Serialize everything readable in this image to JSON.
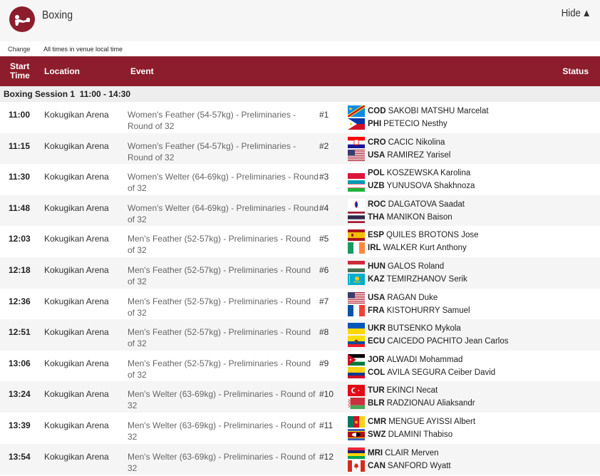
{
  "header": {
    "sport": "Boxing",
    "hide_label": "Hide"
  },
  "subbar": {
    "change_label": "Change",
    "timezone_note": "All times in venue local time"
  },
  "columns": {
    "start_time": "Start Time",
    "location": "Location",
    "event": "Event",
    "status": "Status"
  },
  "session": {
    "label": "Boxing Session 1  11:00 - 14:30"
  },
  "rows": [
    {
      "time": "11:00",
      "location": "Kokugikan Arena",
      "event": "Women's Feather (54-57kg) - Preliminaries - Round of 32",
      "num": "#1",
      "a": {
        "noc": "COD",
        "name": "SAKOBI MATSHU Marcelat",
        "flag": "cod"
      },
      "b": {
        "noc": "PHI",
        "name": "PETECIO Nesthy",
        "flag": "phi"
      }
    },
    {
      "time": "11:15",
      "location": "Kokugikan Arena",
      "event": "Women's Feather (54-57kg) - Preliminaries - Round of 32",
      "num": "#2",
      "a": {
        "noc": "CRO",
        "name": "CACIC Nikolina",
        "flag": "cro"
      },
      "b": {
        "noc": "USA",
        "name": "RAMIREZ Yarisel",
        "flag": "usa"
      }
    },
    {
      "time": "11:30",
      "location": "Kokugikan Arena",
      "event": "Women's Welter (64-69kg) - Preliminaries - Round of 32",
      "num": "#3",
      "a": {
        "noc": "POL",
        "name": "KOSZEWSKA Karolina",
        "flag": "pol"
      },
      "b": {
        "noc": "UZB",
        "name": "YUNUSOVA Shakhnoza",
        "flag": "uzb"
      }
    },
    {
      "time": "11:48",
      "location": "Kokugikan Arena",
      "event": "Women's Welter (64-69kg) - Preliminaries - Round of 32",
      "num": "#4",
      "a": {
        "noc": "ROC",
        "name": "DALGATOVA Saadat",
        "flag": "roc"
      },
      "b": {
        "noc": "THA",
        "name": "MANIKON Baison",
        "flag": "tha"
      }
    },
    {
      "time": "12:03",
      "location": "Kokugikan Arena",
      "event": "Men's Feather (52-57kg) - Preliminaries - Round of 32",
      "num": "#5",
      "a": {
        "noc": "ESP",
        "name": "QUILES BROTONS Jose",
        "flag": "esp"
      },
      "b": {
        "noc": "IRL",
        "name": "WALKER Kurt Anthony",
        "flag": "irl"
      }
    },
    {
      "time": "12:18",
      "location": "Kokugikan Arena",
      "event": "Men's Feather (52-57kg) - Preliminaries - Round of 32",
      "num": "#6",
      "a": {
        "noc": "HUN",
        "name": "GALOS Roland",
        "flag": "hun"
      },
      "b": {
        "noc": "KAZ",
        "name": "TEMIRZHANOV Serik",
        "flag": "kaz"
      }
    },
    {
      "time": "12:36",
      "location": "Kokugikan Arena",
      "event": "Men's Feather (52-57kg) - Preliminaries - Round of 32",
      "num": "#7",
      "a": {
        "noc": "USA",
        "name": "RAGAN Duke",
        "flag": "usa"
      },
      "b": {
        "noc": "FRA",
        "name": "KISTOHURRY Samuel",
        "flag": "fra"
      }
    },
    {
      "time": "12:51",
      "location": "Kokugikan Arena",
      "event": "Men's Feather (52-57kg) - Preliminaries - Round of 32",
      "num": "#8",
      "a": {
        "noc": "UKR",
        "name": "BUTSENKO Mykola",
        "flag": "ukr"
      },
      "b": {
        "noc": "ECU",
        "name": "CAICEDO PACHITO Jean Carlos",
        "flag": "ecu"
      }
    },
    {
      "time": "13:06",
      "location": "Kokugikan Arena",
      "event": "Men's Feather (52-57kg) - Preliminaries - Round of 32",
      "num": "#9",
      "a": {
        "noc": "JOR",
        "name": "ALWADI Mohammad",
        "flag": "jor"
      },
      "b": {
        "noc": "COL",
        "name": "AVILA SEGURA Ceiber David",
        "flag": "col"
      }
    },
    {
      "time": "13:24",
      "location": "Kokugikan Arena",
      "event": "Men's Welter (63-69kg) - Preliminaries - Round of 32",
      "num": "#10",
      "a": {
        "noc": "TUR",
        "name": "EKINCI Necat",
        "flag": "tur"
      },
      "b": {
        "noc": "BLR",
        "name": "RADZIONAU Aliaksandr",
        "flag": "blr"
      }
    },
    {
      "time": "13:39",
      "location": "Kokugikan Arena",
      "event": "Men's Welter (63-69kg) - Preliminaries - Round of 32",
      "num": "#11",
      "a": {
        "noc": "CMR",
        "name": "MENGUE AYISSI Albert",
        "flag": "cmr"
      },
      "b": {
        "noc": "SWZ",
        "name": "DLAMINI Thabiso",
        "flag": "swz"
      }
    },
    {
      "time": "13:54",
      "location": "Kokugikan Arena",
      "event": "Men's Welter (63-69kg) - Preliminaries - Round of 32",
      "num": "#12",
      "a": {
        "noc": "MRI",
        "name": "CLAIR Merven",
        "flag": "mri"
      },
      "b": {
        "noc": "CAN",
        "name": "SANFORD Wyatt",
        "flag": "can"
      }
    }
  ]
}
